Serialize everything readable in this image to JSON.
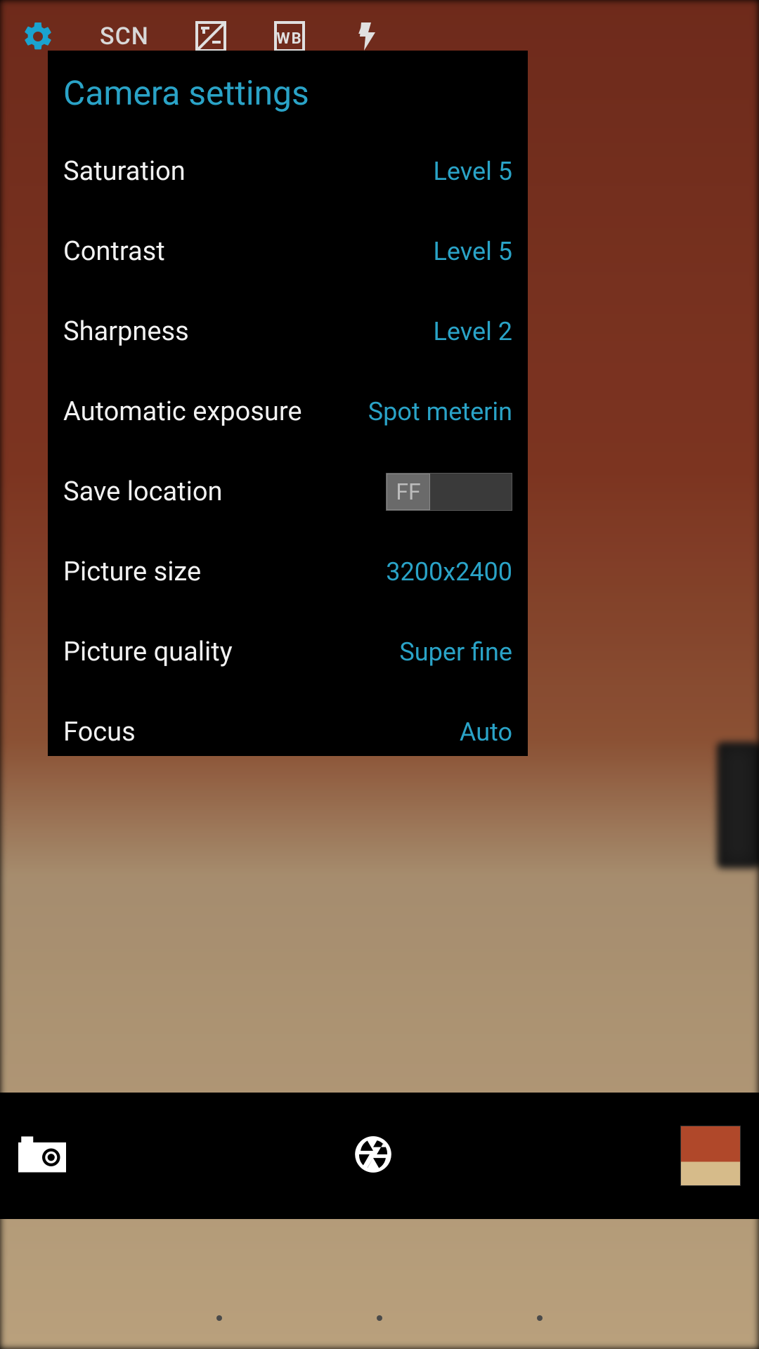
{
  "colors": {
    "accent": "#2aa3c7"
  },
  "toolbar": {
    "scene_label": "SCN",
    "wb_label": "WB"
  },
  "dialog": {
    "title": "Camera settings",
    "items": [
      {
        "label": "Saturation",
        "value": "Level 5"
      },
      {
        "label": "Contrast",
        "value": "Level 5"
      },
      {
        "label": "Sharpness",
        "value": "Level 2"
      },
      {
        "label": "Automatic exposure",
        "value": "Spot meterin"
      },
      {
        "label": "Save location",
        "toggle_state": "FF"
      },
      {
        "label": "Picture size",
        "value": "3200x2400"
      },
      {
        "label": "Picture quality",
        "value": "Super fine"
      },
      {
        "label": "Focus",
        "value": "Auto"
      }
    ]
  }
}
